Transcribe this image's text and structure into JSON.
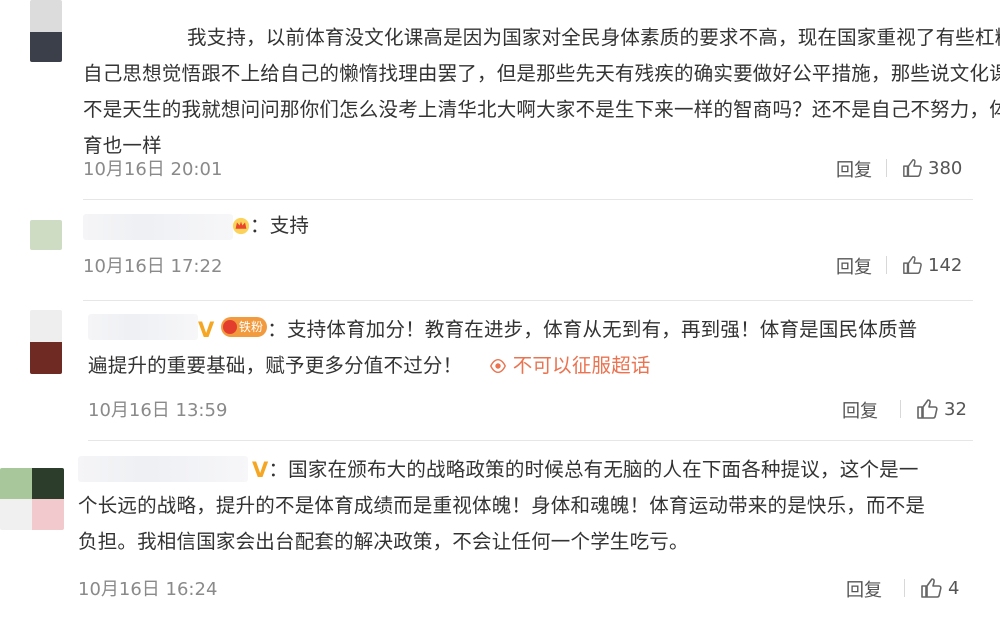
{
  "comments": [
    {
      "text_lines": [
        "我支持，以前体育没文化课高是因为国家对全民身体素质的要求不高，现在国家重视了有些杠精",
        "自己思想觉悟跟不上给自己的懒惰找理由罢了，但是那些先天有残疾的确实要做好公平措施，那些说文化课",
        "不是天生的我就想问问那你们怎么没考上清华北大啊大家不是生下来一样的智商吗？还不是自己不努力，体",
        "育也一样"
      ],
      "time": "10月16日 20:01",
      "reply_label": "回复",
      "likes": "380"
    },
    {
      "prefix": "：",
      "content": "支持",
      "time": "10月16日 17:22",
      "reply_label": "回复",
      "likes": "142",
      "badges": [
        "crown-icon"
      ]
    },
    {
      "badge_text": "铁粉",
      "prefix": "：",
      "line1": "支持体育加分！教育在进步，体育从无到有，再到强！体育是国民体质普",
      "line2": "遍提升的重要基础，赋予更多分值不过分！",
      "super_topic_label": "不可以征服超话",
      "time": "10月16日 13:59",
      "reply_label": "回复",
      "likes": "32"
    },
    {
      "prefix": "：",
      "line1": "国家在颁布大的战略政策的时候总有无脑的人在下面各种提议，这个是一",
      "line2": "个长远的战略，提升的不是体育成绩而是重视体魄！身体和魂魄！体育运动带来的是快乐，而不是",
      "line3": "负担。我相信国家会出台配套的解决政策，不会让任何一个学生吃亏。",
      "time": "10月16日 16:24",
      "reply_label": "回复",
      "likes": "4"
    }
  ],
  "colors": {
    "vip": "#f5a623",
    "link": "#eb7350",
    "time": "#8a8a8a"
  },
  "icons": [
    "thumbs-up-icon",
    "vip-v-icon",
    "crown-icon",
    "super-topic-icon"
  ]
}
